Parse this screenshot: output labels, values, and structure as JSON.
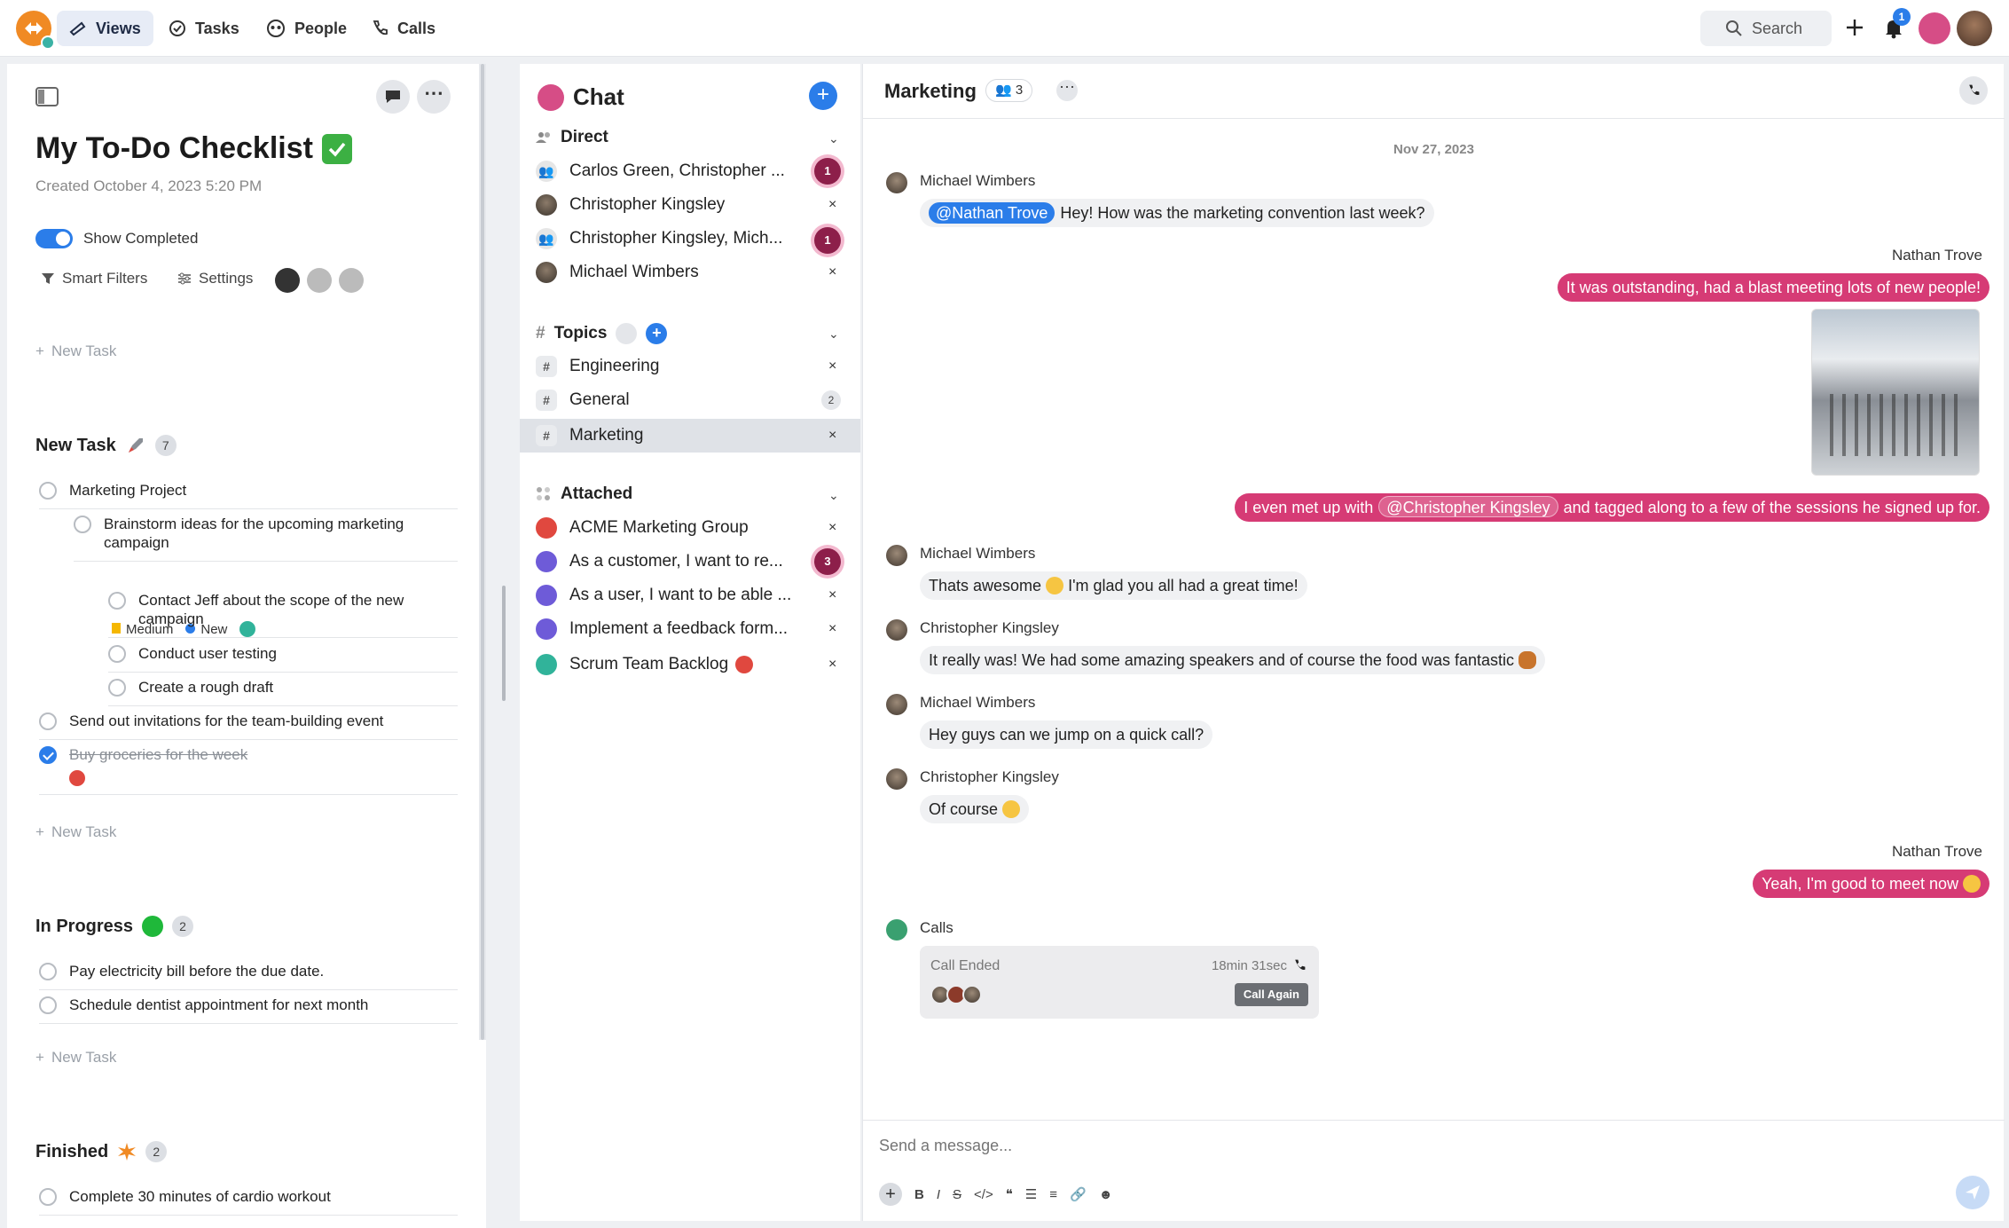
{
  "topbar": {
    "nav": [
      {
        "label": "Views",
        "icon": "telescope-icon"
      },
      {
        "label": "Tasks",
        "icon": "check-circle-icon"
      },
      {
        "label": "People",
        "icon": "people-icon"
      },
      {
        "label": "Calls",
        "icon": "phone-icon"
      }
    ],
    "search_label": "Search",
    "notification_count": "1"
  },
  "todo": {
    "title": "My To-Do Checklist",
    "created": "Created October 4, 2023 5:20 PM",
    "show_completed": "Show Completed",
    "smart_filters": "Smart Filters",
    "settings": "Settings",
    "new_task_label": "New Task",
    "sections": [
      {
        "title": "New Task",
        "count": "7"
      },
      {
        "title": "In Progress",
        "count": "2"
      },
      {
        "title": "Finished",
        "count": "2"
      }
    ],
    "tasks_new": [
      "Marketing Project",
      "Brainstorm ideas for the upcoming marketing campaign",
      "Contact Jeff about the scope of the new campaign",
      "Conduct user testing",
      "Create a rough draft",
      "Send out invitations for the team-building event",
      "Buy groceries for the week"
    ],
    "tags": {
      "priority": "Medium",
      "status": "New"
    },
    "tasks_in_progress": [
      "Pay electricity bill before the due date.",
      "Schedule dentist appointment for next month"
    ],
    "tasks_finished": [
      "Complete 30 minutes of cardio workout"
    ]
  },
  "chatlist": {
    "title": "Chat",
    "direct_label": "Direct",
    "direct": [
      {
        "name": "Carlos Green, Christopher ...",
        "unread": "1"
      },
      {
        "name": "Christopher Kingsley",
        "unread": ""
      },
      {
        "name": "Christopher Kingsley, Mich...",
        "unread": "1"
      },
      {
        "name": "Michael Wimbers",
        "unread": ""
      }
    ],
    "topics_label": "Topics",
    "topics": [
      {
        "name": "Engineering",
        "count": ""
      },
      {
        "name": "General",
        "count": "2"
      },
      {
        "name": "Marketing",
        "count": ""
      }
    ],
    "attached_label": "Attached",
    "attached": [
      {
        "name": "ACME Marketing Group",
        "unread": ""
      },
      {
        "name": "As a customer, I want to re...",
        "unread": "3"
      },
      {
        "name": "As a user, I want to be able ...",
        "unread": ""
      },
      {
        "name": "Implement a feedback form...",
        "unread": ""
      },
      {
        "name": "Scrum Team Backlog",
        "unread": ""
      }
    ]
  },
  "conversation": {
    "title": "Marketing",
    "members": "3",
    "date": "Nov 27, 2023",
    "messages": [
      {
        "sender": "Michael Wimbers",
        "mention": "@Nathan Trove",
        "text": "Hey! How was the marketing convention last week?"
      },
      {
        "sender": "Nathan Trove",
        "text": "It was outstanding, had a blast meeting lots of new people!"
      },
      {
        "text_pre": "I even met up with",
        "mention": "@Christopher Kingsley",
        "text_post": "and tagged along to a few of the sessions he signed up for."
      },
      {
        "sender": "Michael Wimbers",
        "text_pre": "Thats awesome",
        "text_post": "I'm glad you all had a great time!"
      },
      {
        "sender": "Christopher Kingsley",
        "text": "It really was! We had some amazing speakers and of course the food was fantastic"
      },
      {
        "sender": "Michael Wimbers",
        "text": "Hey guys can we jump on a quick call?"
      },
      {
        "sender": "Christopher Kingsley",
        "text": "Of course"
      },
      {
        "sender": "Nathan Trove",
        "text": "Yeah, I'm good to meet now"
      }
    ],
    "calls": {
      "sender": "Calls",
      "status": "Call Ended",
      "duration": "18min 31sec",
      "action": "Call Again"
    },
    "composer_placeholder": "Send a message..."
  },
  "colors": {
    "accent": "#2b7de9",
    "mine_bubble": "#d63b75",
    "brand_orange": "#f08a24"
  }
}
